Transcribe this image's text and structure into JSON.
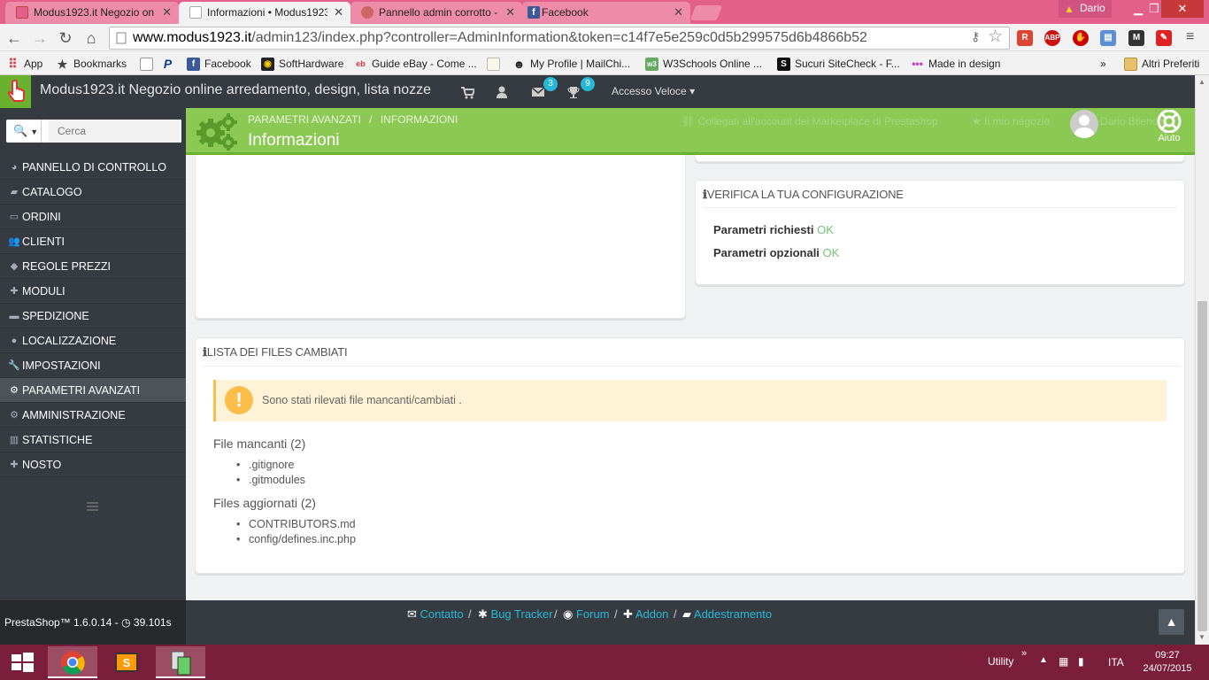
{
  "browser": {
    "tabs": [
      {
        "label": "Modus1923.it Negozio on",
        "active": false,
        "color": "#e2608a"
      },
      {
        "label": "Informazioni • Modus1923",
        "active": true,
        "color": "#f2f2f2"
      },
      {
        "label": "Pannello admin corrotto -",
        "active": false,
        "color": "#e2608a"
      },
      {
        "label": "Facebook",
        "active": false,
        "color": "#e2608a"
      }
    ],
    "user": "Dario",
    "url_host": "www.modus1923.it",
    "url_rest": "/admin123/index.php?controller=AdminInformation&token=c14f7e5e259c0d5b299575d6b4866b52",
    "bookmarks": [
      {
        "label": "App",
        "icon": "apps-icon"
      },
      {
        "label": "Bookmarks",
        "icon": "star-icon"
      },
      {
        "label": "",
        "icon": "page-icon"
      },
      {
        "label": "",
        "icon": "paypal-icon"
      },
      {
        "label": "Facebook",
        "icon": "facebook-icon"
      },
      {
        "label": "SoftHardware",
        "icon": "softhardware-icon"
      },
      {
        "label": "Guide eBay - Come ...",
        "icon": "ebay-icon"
      },
      {
        "label": "",
        "icon": "page-icon"
      },
      {
        "label": "My Profile | MailChi...",
        "icon": "mailchimp-icon"
      },
      {
        "label": "W3Schools Online ...",
        "icon": "w3schools-icon"
      },
      {
        "label": "Sucuri SiteCheck - F...",
        "icon": "sucuri-icon"
      },
      {
        "label": "Made in design",
        "icon": "dots-icon"
      }
    ],
    "other_bookmarks": "Altri Preferiti",
    "overflow": "»"
  },
  "header": {
    "shop_name": "Modus1923.it Negozio online arredamento, design, lista nozze",
    "messages_count": "3",
    "trophy_count": "9",
    "quick_access": "Accesso Veloce"
  },
  "sidebar": {
    "search_placeholder": "Cerca",
    "items": [
      {
        "label": "PANNELLO DI CONTROLLO",
        "icon": "dashboard-icon",
        "active": false
      },
      {
        "label": "CATALOGO",
        "icon": "book-icon",
        "active": false
      },
      {
        "label": "ORDINI",
        "icon": "credit-card-icon",
        "active": false
      },
      {
        "label": "CLIENTI",
        "icon": "users-icon",
        "active": false
      },
      {
        "label": "REGOLE PREZZI",
        "icon": "tags-icon",
        "active": false
      },
      {
        "label": "MODULI",
        "icon": "puzzle-icon",
        "active": false
      },
      {
        "label": "SPEDIZIONE",
        "icon": "truck-icon",
        "active": false
      },
      {
        "label": "LOCALIZZAZIONE",
        "icon": "globe-icon",
        "active": false
      },
      {
        "label": "IMPOSTAZIONI",
        "icon": "wrench-icon",
        "active": false
      },
      {
        "label": "PARAMETRI AVANZATI",
        "icon": "cogs-icon",
        "active": true
      },
      {
        "label": "AMMINISTRAZIONE",
        "icon": "cog-icon",
        "active": false
      },
      {
        "label": "STATISTICHE",
        "icon": "bar-chart-icon",
        "active": false
      },
      {
        "label": "NOSTO",
        "icon": "puzzle-icon",
        "active": false
      }
    ],
    "version": "PrestaShop™ 1.6.0.14 - ",
    "load_time": "39.101s"
  },
  "toolbar": {
    "breadcrumb": [
      "PARAMETRI AVANZATI",
      "/",
      "INFORMAZIONI"
    ],
    "page_title": "Informazioni",
    "marketplace_link": "Collegati all'account del Marketplace di Prestashop",
    "my_shop": "Il mio negozio",
    "user_name": "Dario Bilenchi",
    "help": "Aiuto"
  },
  "config_panel": {
    "title": "VERIFICA LA TUA CONFIGURAZIONE",
    "required_label": "Parametri richiesti",
    "required_value": "OK",
    "optional_label": "Parametri opzionali",
    "optional_value": "OK"
  },
  "files_panel": {
    "title": "LISTA DEI FILES CAMBIATI",
    "warning": "Sono stati rilevati file mancanti/cambiati .",
    "missing_title": "File mancanti (2)",
    "missing": [
      ".gitignore",
      ".gitmodules"
    ],
    "updated_title": "Files aggiornati (2)",
    "updated": [
      "CONTRIBUTORS.md",
      "config/defines.inc.php"
    ]
  },
  "footer": {
    "links": [
      "Contatto",
      "Bug Tracker",
      "Forum",
      "Addon",
      "Addestramento"
    ],
    "separator": "/"
  },
  "taskbar": {
    "tray_label": "Utility",
    "tray_chevron": "»",
    "language": "ITA",
    "time": "09:27",
    "date": "24/07/2015"
  }
}
